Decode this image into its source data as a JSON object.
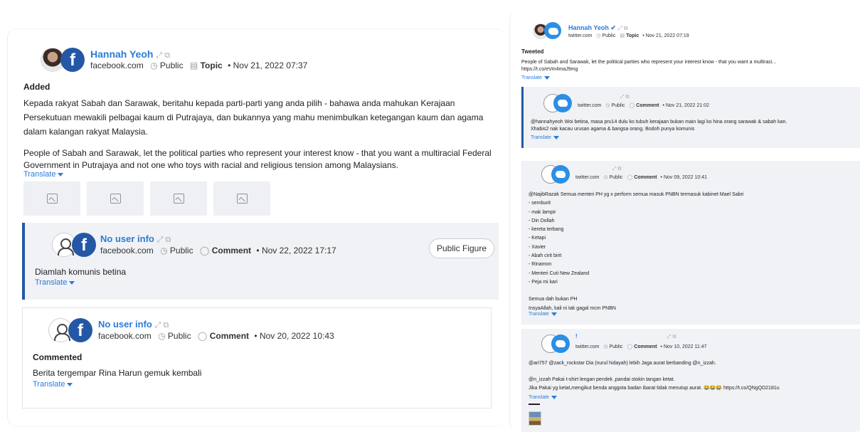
{
  "left": {
    "post": {
      "author": "Hannah Yeoh",
      "source": "facebook.com",
      "visibility": "Public",
      "type": "Topic",
      "datetime": "Nov 21, 2022 07:37",
      "action": "Added",
      "text_ms": "Kepada rakyat Sabah dan Sarawak, beritahu kepada parti-parti yang anda pilih - bahawa anda mahukan Kerajaan Persekutuan mewakili pelbagai kaum di Putrajaya, dan bukannya yang mahu menimbulkan ketegangan kaum dan agama dalam kalangan rakyat Malaysia.",
      "text_en": "People of Sabah and Sarawak, let the political parties who represent your interest know - that you want a multiracial Federal Government in Putrajaya and not one who toys with racial and religious tension among Malaysians.",
      "translate": "Translate"
    },
    "comments": [
      {
        "author": "No user info",
        "source": "facebook.com",
        "visibility": "Public",
        "type": "Comment",
        "datetime": "Nov 22, 2022 17:17",
        "badge": "Public Figure",
        "text": "Diamlah komunis betina",
        "translate": "Translate"
      },
      {
        "author": "No user info",
        "source": "facebook.com",
        "visibility": "Public",
        "type": "Comment",
        "datetime": "Nov 20, 2022 10:43",
        "action": "Commented",
        "text": "Berita tergempar Rina Harun gemuk kembali",
        "translate": "Translate"
      }
    ]
  },
  "right": {
    "post": {
      "author": "Hannah Yeoh",
      "source": "twitter.com",
      "visibility": "Public",
      "type": "Topic",
      "datetime": "Nov 21, 2022 07:19",
      "action": "Tweeted",
      "text": "People of Sabah and Sarawak, let the political parties who represent your interest know - that you want a multiraci...",
      "link": "https://t.co/eVm4maJ9mg",
      "translate": "Translate"
    },
    "comments": [
      {
        "source": "twitter.com",
        "visibility": "Public",
        "type": "Comment",
        "datetime": "Nov 21, 2022 21:02",
        "line1": "@hannahyeoh Woi betina, masa pru14 dulu ko tubuh kerajaan bukan main lagi ko hina orang sarawak & sabah kan.",
        "line2": "Xhabis2 nak kacau urusan agama & bangsa orang. Bodoh punya komunis",
        "translate": "Translate"
      },
      {
        "source": "twitter.com",
        "visibility": "Public",
        "type": "Comment",
        "datetime": "Nov 09, 2022 10:41",
        "lines": [
          "@NajibRazak Semua menteri PH yg x perform semua masuk PNBN termasuk kabinet Mael Sabri",
          "- semburit",
          "- mak lampir",
          "- Din Dollah",
          "- kereta terbang",
          "- Ketapi",
          "- Xavier",
          "- Abah cirit birit",
          "- Rinamon",
          "- Menteri Cuti New Zealand",
          "- Peja mi kari",
          "",
          "Semua dah bukan PH",
          "InsyaAllah, kali ni tak gagal mcm PNBN"
        ],
        "translate": "Translate"
      },
      {
        "name_fragment": "!",
        "source": "twitter.com",
        "visibility": "Public",
        "type": "Comment",
        "datetime": "Nov 10, 2022 11:47",
        "line1": "@ari757 @zack_rockstar Dia (nurul hidayah) lebih Jaga aurat berbanding @n_izzah.",
        "line2": "@n_izzah Pakai t-shirt lengan pendek ,pandai stokin tangan ketat.",
        "line3": "Jika Pakai yg ketat,mengikut benda anggota badan ibarat tidak menutup aurat. 😂😂😂 https://t.co/QNgQD2181u",
        "translate": "Translate"
      }
    ]
  }
}
